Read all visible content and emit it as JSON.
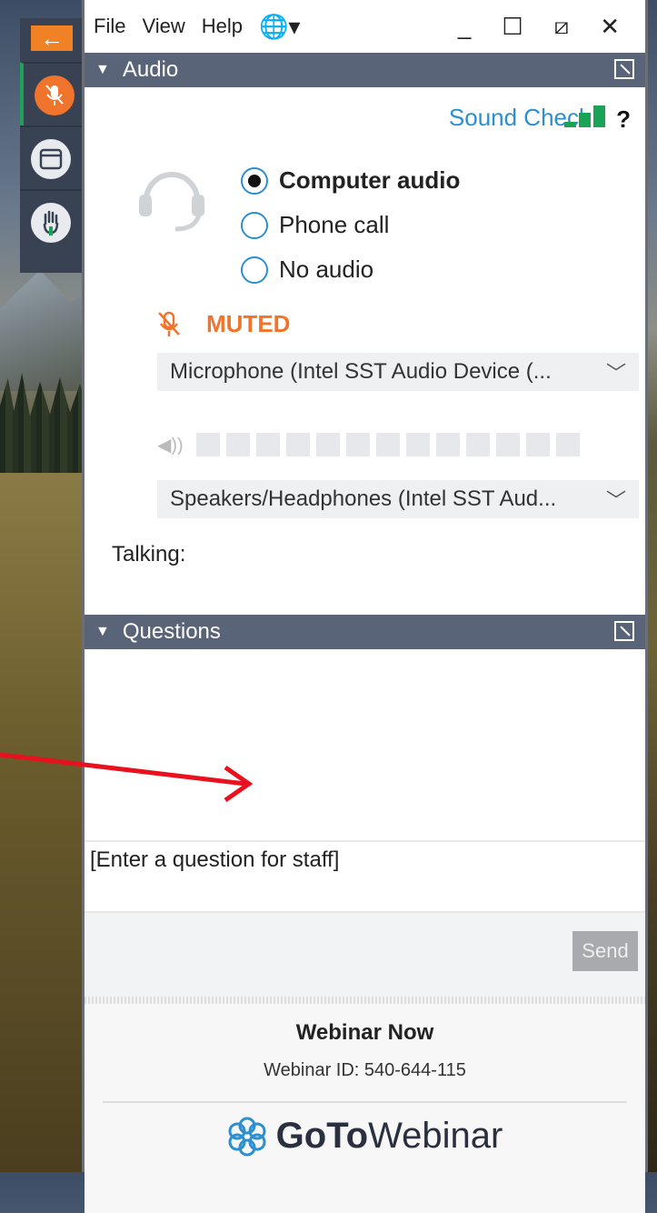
{
  "menu": {
    "file": "File",
    "view": "View",
    "help": "Help"
  },
  "audio": {
    "header": "Audio",
    "sound_check": "Sound Check",
    "help": "?",
    "options": [
      {
        "label": "Computer audio",
        "selected": true
      },
      {
        "label": "Phone call",
        "selected": false
      },
      {
        "label": "No audio",
        "selected": false
      }
    ],
    "muted_label": "MUTED",
    "microphone": "Microphone (Intel SST Audio Device (...",
    "speakers": "Speakers/Headphones (Intel SST Aud...",
    "talking_label": "Talking:",
    "signal_level": 3,
    "volume_segments": 13
  },
  "questions": {
    "header": "Questions",
    "placeholder": "[Enter a question for staff]",
    "send": "Send"
  },
  "footer": {
    "webinar_name": "Webinar Now",
    "webinar_id": "Webinar ID: 540-644-115",
    "logo_goto": "GoTo",
    "logo_webinar": "Webinar"
  },
  "colors": {
    "accent_orange": "#f0742b",
    "link_blue": "#2b8fd0",
    "signal_green": "#1aa356",
    "header_slate": "#5a6478"
  }
}
